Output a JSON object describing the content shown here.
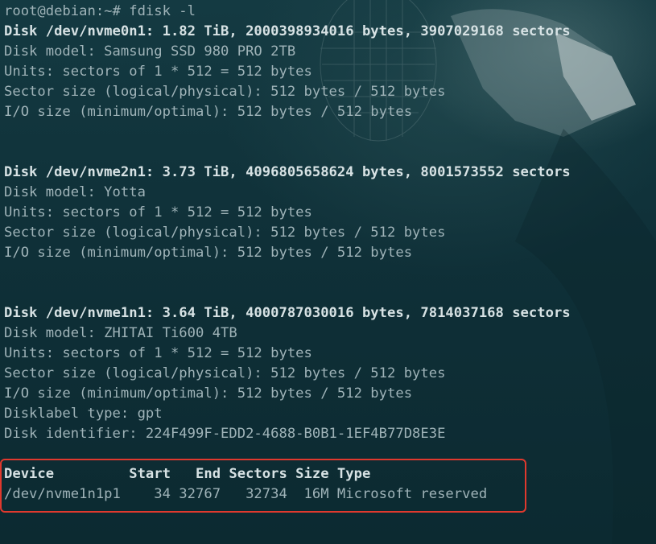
{
  "terminal": {
    "prompt_line": "root@debian:~# fdisk -l",
    "disk1": {
      "header": "Disk /dev/nvme0n1: 1.82 TiB, 2000398934016 bytes, 3907029168 sectors",
      "model": "Disk model: Samsung SSD 980 PRO 2TB",
      "units": "Units: sectors of 1 * 512 = 512 bytes",
      "sector_size": "Sector size (logical/physical): 512 bytes / 512 bytes",
      "io_size": "I/O size (minimum/optimal): 512 bytes / 512 bytes"
    },
    "disk2": {
      "header": "Disk /dev/nvme2n1: 3.73 TiB, 4096805658624 bytes, 8001573552 sectors",
      "model": "Disk model: Yotta",
      "units": "Units: sectors of 1 * 512 = 512 bytes",
      "sector_size": "Sector size (logical/physical): 512 bytes / 512 bytes",
      "io_size": "I/O size (minimum/optimal): 512 bytes / 512 bytes"
    },
    "disk3": {
      "header": "Disk /dev/nvme1n1: 3.64 TiB, 4000787030016 bytes, 7814037168 sectors",
      "model": "Disk model: ZHITAI Ti600 4TB",
      "units": "Units: sectors of 1 * 512 = 512 bytes",
      "sector_size": "Sector size (logical/physical): 512 bytes / 512 bytes",
      "io_size": "I/O size (minimum/optimal): 512 bytes / 512 bytes",
      "label_type": "Disklabel type: gpt",
      "identifier": "Disk identifier: 224F499F-EDD2-4688-B0B1-1EF4B77D8E3E"
    },
    "partition_table": {
      "header": "Device         Start   End Sectors Size Type",
      "rows": [
        "/dev/nvme1n1p1    34 32767   32734  16M Microsoft reserved"
      ]
    }
  },
  "colors": {
    "text": "#9fb3b8",
    "bold_text": "#d7e2e4",
    "highlight_border": "#e0392e",
    "background": "#0f3038"
  }
}
